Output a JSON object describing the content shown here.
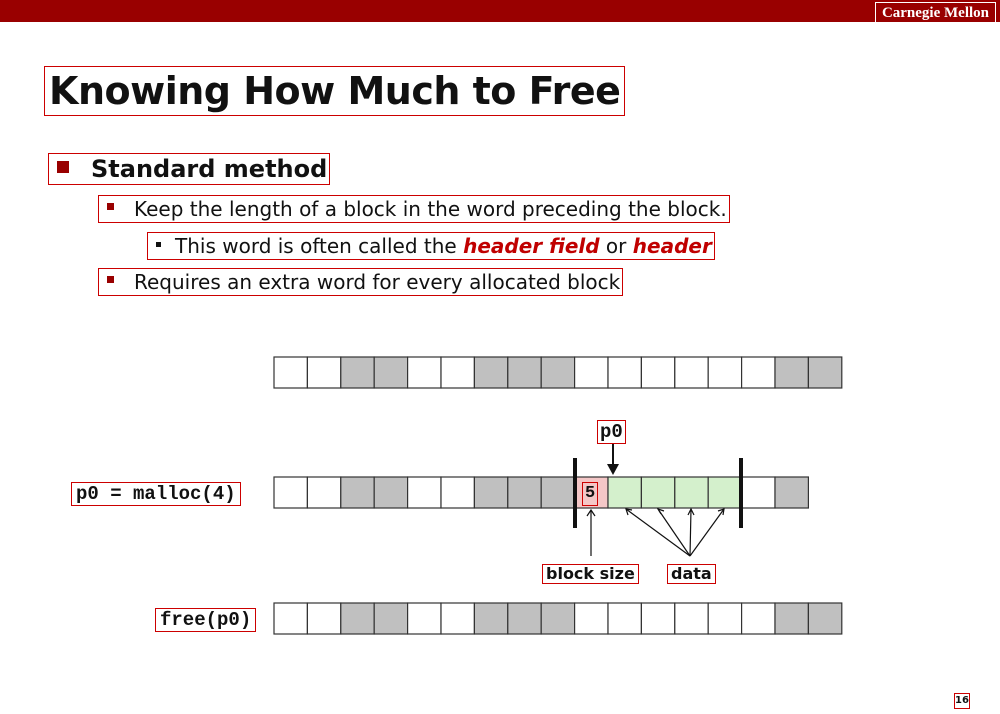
{
  "header": {
    "brand": "Carnegie Mellon"
  },
  "slide": {
    "title": "Knowing How Much to Free",
    "bullets": {
      "standard_method": "Standard method",
      "keep_length": "Keep the length of a block in the word preceding the block.",
      "word_called_pre": "This word is often called the ",
      "word_called_header_field": "header field",
      "word_called_or": " or ",
      "word_called_header": "header",
      "requires_extra": "Requires an extra word for every allocated block"
    },
    "page_number": "16"
  },
  "diagram": {
    "labels": {
      "malloc_call": "p0 = malloc(4)",
      "free_call": "free(p0)",
      "pointer": "p0",
      "block_size_value": "5",
      "block_size_label": "block size",
      "data_label": "data"
    },
    "colors": {
      "used": "#c0c0c0",
      "free": "#ffffff",
      "header": "#f4c7c7",
      "payload": "#d4f0cc",
      "accent": "#990000"
    },
    "rows": {
      "before": [
        "free",
        "free",
        "used",
        "used",
        "free",
        "free",
        "used",
        "used",
        "used",
        "free",
        "free",
        "free",
        "free",
        "free",
        "free",
        "used",
        "used"
      ],
      "after_malloc": [
        "free",
        "free",
        "used",
        "used",
        "free",
        "free",
        "used",
        "used",
        "used",
        "header",
        "payload",
        "payload",
        "payload",
        "payload",
        "free",
        "used"
      ],
      "after_free": [
        "free",
        "free",
        "used",
        "used",
        "free",
        "free",
        "used",
        "used",
        "used",
        "free",
        "free",
        "free",
        "free",
        "free",
        "free",
        "used",
        "used"
      ]
    }
  }
}
